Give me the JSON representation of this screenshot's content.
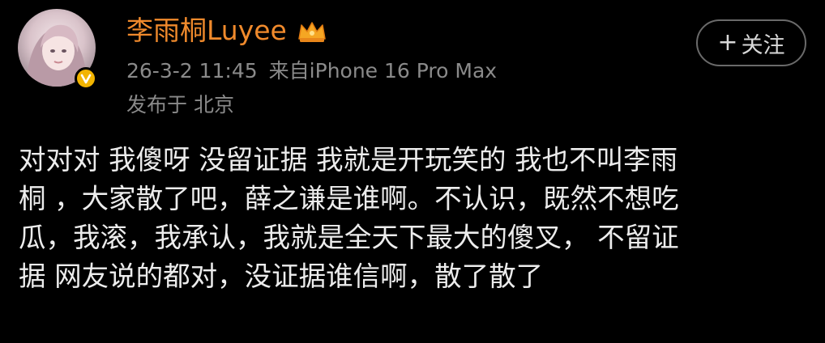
{
  "user": {
    "name": "李雨桐Luyee",
    "avatar_icon": "avatar-photo",
    "verified_icon": "verified-v-icon",
    "crown_icon": "crown-icon",
    "accent_color": "#f08a2c"
  },
  "meta": {
    "time": "26-3-2 11:45",
    "source": "来自iPhone 16 Pro Max",
    "location": "发布于 北京"
  },
  "follow": {
    "plus": "+",
    "label": "关注"
  },
  "post": {
    "lines": [
      "对对对 我傻呀 没留证据 我就是开玩笑的 我也不叫李雨",
      "桐 ，大家散了吧，薛之谦是谁啊。不认识，既然不想吃",
      "瓜，我滚，我承认，我就是全天下最大的傻叉， 不留证",
      "据 网友说的都对，没证据谁信啊，散了散了"
    ]
  }
}
